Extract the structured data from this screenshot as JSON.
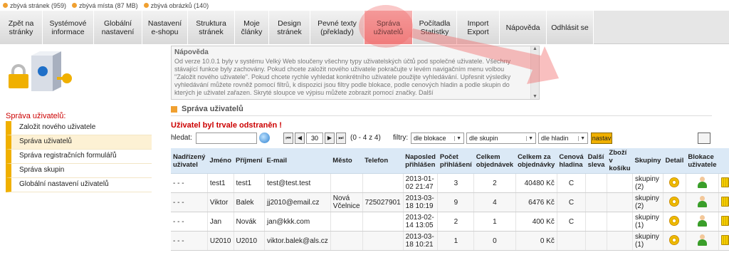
{
  "topbar": {
    "stats": [
      "zbývá stránek (959)",
      "zbývá místa (87 MB)",
      "zbývá obrázků (140)"
    ]
  },
  "nav": {
    "items": [
      {
        "label": "Zpět na\nstránky"
      },
      {
        "label": "Systémové\ninformace"
      },
      {
        "label": "Globální\nnastavení"
      },
      {
        "label": "Nastavení\ne-shopu"
      },
      {
        "label": "Struktura\nstránek"
      },
      {
        "label": "Moje\nčlánky"
      },
      {
        "label": "Design\nstránek"
      },
      {
        "label": "Pevné texty\n(překlady)"
      },
      {
        "label": "Správa\nuživatelů",
        "active": true
      },
      {
        "label": "Počítadla\nStatistky"
      },
      {
        "label": "Import\nExport"
      },
      {
        "label": "Nápověda"
      },
      {
        "label": "Odhlásit se"
      }
    ]
  },
  "help": {
    "title": "Nápověda",
    "text": "Od verze 10.0.1 byly v systému Velký Web sloučeny všechny typy uživatelských účtů pod společné uživatele. Všechny stávající funkce byly zachovány. Pokud chcete založit nového uživatele pokračujte v levém navigačním menu volbou \"Založit nového uživatele\". Pokud chcete rychle vyhledat konkrétního uživatele použijte vyhledávání. Upřesnit výsledky vyhledávání můžete rovněž pomocí filtrů, k dispozici jsou filtry podle blokace, podle cenových hladin a podle skupin do kterých je uživatel zařazen. Skryté sloupce ve výpisu můžete zobrazit pomocí značky. Další"
  },
  "sidebar": {
    "title": "Správa uživatelů:",
    "items": [
      {
        "label": "Založit nového uživatele"
      },
      {
        "label": "Správa uživatelů",
        "active": true
      },
      {
        "label": "Správa registračních formulářů"
      },
      {
        "label": "Správa skupin"
      },
      {
        "label": "Globální nastavení uživatelů"
      }
    ]
  },
  "section": {
    "title": "Správa uživatelů"
  },
  "message": "Uživatel byl trvale odstraněn !",
  "filters": {
    "search_label": "hledat:",
    "search_value": "",
    "page_value": "30",
    "range": "(0 - 4 z 4)",
    "filters_label": "filtry:",
    "blokace": "dle blokace",
    "skupin": "dle skupin",
    "hladin": "dle hladin",
    "apply": "nastav"
  },
  "table": {
    "headers": [
      "Nadřízený uživatel",
      "Jméno",
      "Příjmení",
      "E-mail",
      "Město",
      "Telefon",
      "Naposled přihlášen",
      "Počet přihlášení",
      "Celkem objednávek",
      "Celkem za objednávky",
      "Cenová hladina",
      "Další sleva",
      "Zboží v košíku",
      "Skupiny",
      "Detail",
      "Blokace uživatele"
    ],
    "rows": [
      {
        "parent": "- - -",
        "first": "test1",
        "last": "test1",
        "email": "test@test.test",
        "city": "",
        "phone": "",
        "last_login": "2013-01-02 21:47",
        "logins": "3",
        "orders": "2",
        "total": "40480 Kč",
        "price": "C",
        "discount": "",
        "cart": "",
        "groups": "skupiny (2)"
      },
      {
        "parent": "- - -",
        "first": "Viktor",
        "last": "Balek",
        "email": "jj2010@email.cz",
        "city": "Nová Včelnice",
        "phone": "725027901",
        "last_login": "2013-03-18 10:19",
        "logins": "9",
        "orders": "4",
        "total": "6476 Kč",
        "price": "C",
        "discount": "",
        "cart": "",
        "groups": "skupiny (2)"
      },
      {
        "parent": "- - -",
        "first": "Jan",
        "last": "Novák",
        "email": "jan@kkk.com",
        "city": "",
        "phone": "",
        "last_login": "2013-02-14 13:05",
        "logins": "2",
        "orders": "1",
        "total": "400 Kč",
        "price": "C",
        "discount": "",
        "cart": "",
        "groups": "skupiny (1)"
      },
      {
        "parent": "- - -",
        "first": "U2010",
        "last": "U2010",
        "email": "viktor.balek@als.cz",
        "city": "",
        "phone": "",
        "last_login": "2013-03-18 10:21",
        "logins": "1",
        "orders": "0",
        "total": "0 Kč",
        "price": "",
        "discount": "",
        "cart": "",
        "groups": "skupiny (1)"
      }
    ]
  },
  "colors": {
    "accent": "#f0b000",
    "alert": "#cc0000",
    "header_bg": "#dbe9f6",
    "nav_active": "#f08a8a"
  }
}
